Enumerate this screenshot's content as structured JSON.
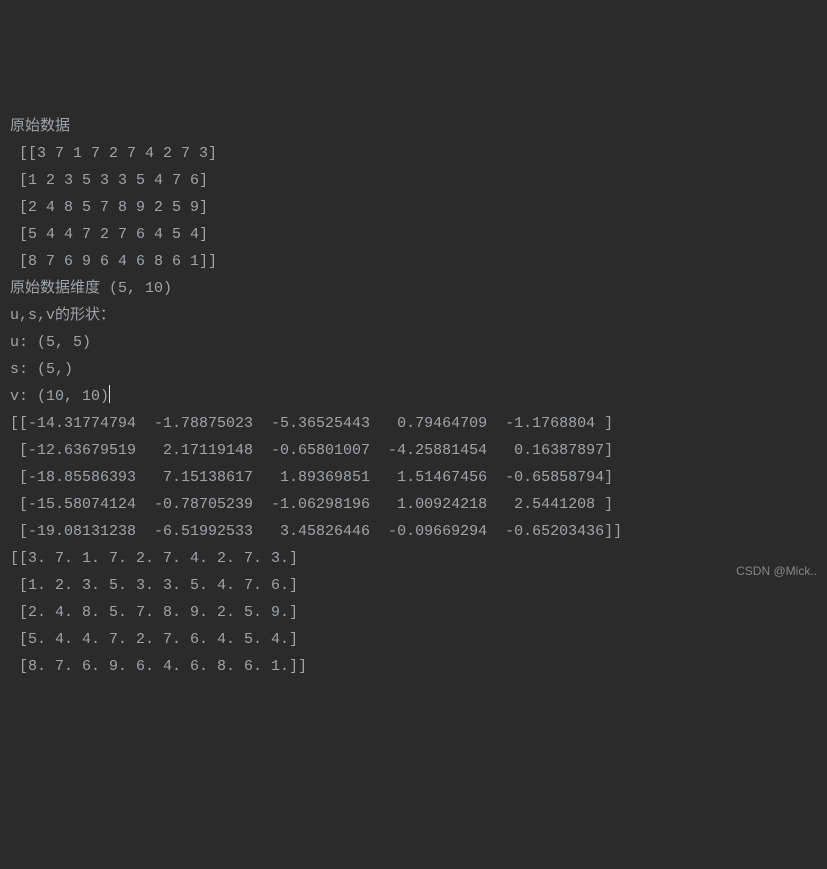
{
  "lines": [
    "原始数据",
    " [[3 7 1 7 2 7 4 2 7 3]",
    " [1 2 3 5 3 3 5 4 7 6]",
    " [2 4 8 5 7 8 9 2 5 9]",
    " [5 4 4 7 2 7 6 4 5 4]",
    " [8 7 6 9 6 4 6 8 6 1]]",
    "原始数据维度 (5, 10)",
    "u,s,v的形状：",
    "u: (5, 5)",
    "s: (5,)",
    "v: (10, 10)",
    "[[-14.31774794  -1.78875023  -5.36525443   0.79464709  -1.1768804 ]",
    " [-12.63679519   2.17119148  -0.65801007  -4.25881454   0.16387897]",
    " [-18.85586393   7.15138617   1.89369851   1.51467456  -0.65858794]",
    " [-15.58074124  -0.78705239  -1.06298196   1.00924218   2.5441208 ]",
    " [-19.08131238  -6.51992533   3.45826446  -0.09669294  -0.65203436]]",
    "[[3. 7. 1. 7. 2. 7. 4. 2. 7. 3.]",
    " [1. 2. 3. 5. 3. 3. 5. 4. 7. 6.]",
    " [2. 4. 8. 5. 7. 8. 9. 2. 5. 9.]",
    " [5. 4. 4. 7. 2. 7. 6. 4. 5. 4.]",
    " [8. 7. 6. 9. 6. 4. 6. 8. 6. 1.]]"
  ],
  "cursor_line_index": 10,
  "watermark": "CSDN @Mick.."
}
